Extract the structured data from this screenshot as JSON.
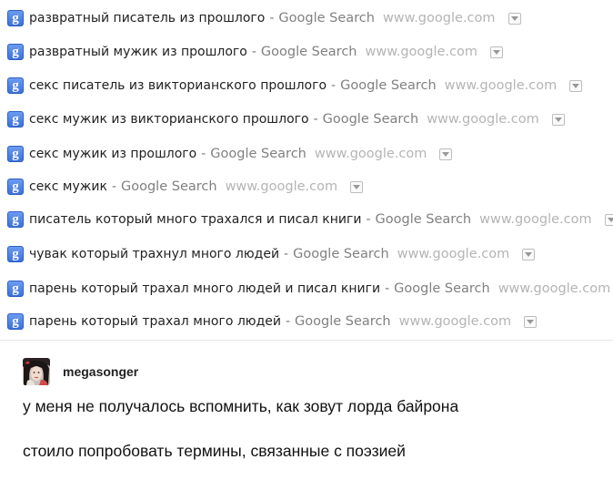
{
  "history": {
    "source_label": "Google Search",
    "separator": "-",
    "url": "www.google.com",
    "icon": "google-search-icon",
    "items": [
      {
        "query": "развратный писатель из прошлого"
      },
      {
        "query": "развратный мужик из прошлого"
      },
      {
        "query": "секс писатель из викторианского прошлого"
      },
      {
        "query": "секс мужик из викторианского прошлого"
      },
      {
        "query": "секс мужик из прошлого"
      },
      {
        "query": "секс мужик"
      },
      {
        "query": "писатель который много трахался и писал книги"
      },
      {
        "query": "чувак который трахнул много людей"
      },
      {
        "query": "парень который трахал много людей и писал книги"
      },
      {
        "query": "парень который трахал много людей"
      }
    ]
  },
  "post": {
    "username": "megasonger",
    "lines": [
      "у меня не получалось вспомнить, как зовут лорда байрона",
      "стоило попробовать термины, связанные с поэзией"
    ]
  },
  "colors": {
    "icon_blue": "#3b71d8",
    "source_gray": "#808080",
    "url_gray": "#b4b4b4"
  }
}
